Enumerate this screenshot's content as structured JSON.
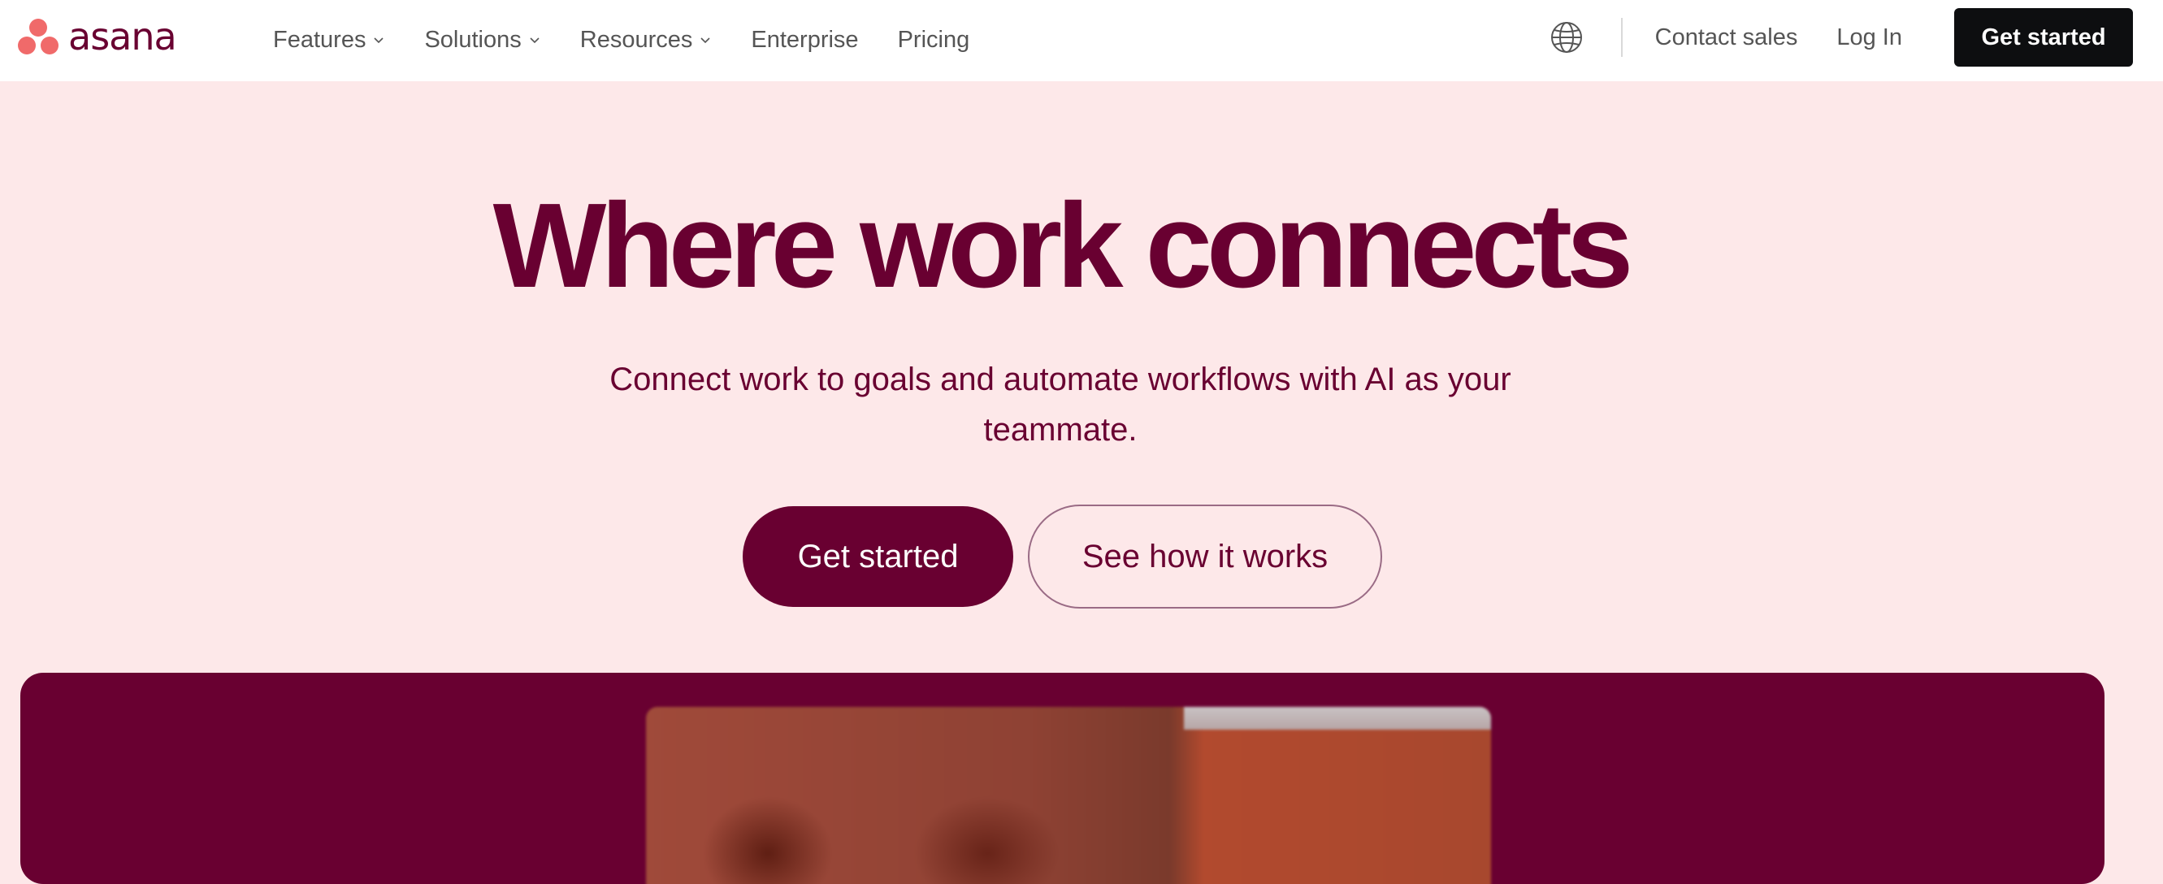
{
  "brand": {
    "name": "asana",
    "logo_color": "#f06a6a",
    "text_color": "#690031"
  },
  "nav": {
    "links": [
      {
        "label": "Features",
        "has_dropdown": true
      },
      {
        "label": "Solutions",
        "has_dropdown": true
      },
      {
        "label": "Resources",
        "has_dropdown": true
      },
      {
        "label": "Enterprise",
        "has_dropdown": false
      },
      {
        "label": "Pricing",
        "has_dropdown": false
      }
    ],
    "globe_icon": "globe-icon",
    "contact_sales": "Contact sales",
    "log_in": "Log In",
    "get_started": "Get started"
  },
  "hero": {
    "title": "Where work connects",
    "subtitle": "Connect work to goals and automate workflows with AI as your teammate.",
    "primary_cta": "Get started",
    "secondary_cta": "See how it works"
  },
  "colors": {
    "page_bg": "#fde8e9",
    "primary": "#690031",
    "nav_button": "#0d0e10",
    "nav_text": "#555555"
  }
}
